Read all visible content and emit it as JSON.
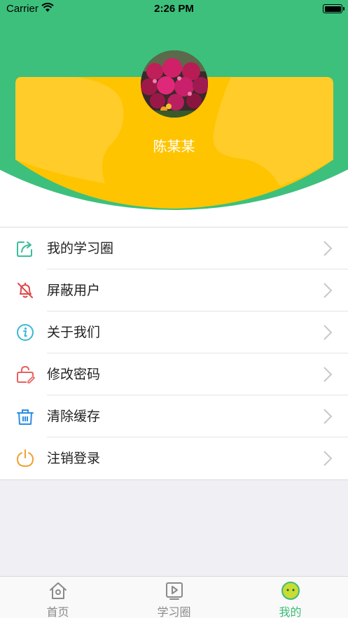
{
  "status_bar": {
    "carrier": "Carrier",
    "time": "2:26 PM"
  },
  "profile": {
    "name": "陈某某",
    "avatar_icon": "flowers-avatar"
  },
  "menu": {
    "items": [
      {
        "label": "我的学习圈",
        "icon": "share-icon",
        "color": "#3cbc9c"
      },
      {
        "label": "屏蔽用户",
        "icon": "bell-off-icon",
        "color": "#e04848"
      },
      {
        "label": "关于我们",
        "icon": "info-icon",
        "color": "#38b8d8"
      },
      {
        "label": "修改密码",
        "icon": "lock-edit-icon",
        "color": "#e86060"
      },
      {
        "label": "清除缓存",
        "icon": "trash-icon",
        "color": "#2a8ee0"
      },
      {
        "label": "注销登录",
        "icon": "power-icon",
        "color": "#f0a030"
      }
    ]
  },
  "tabbar": {
    "tabs": [
      {
        "label": "首页",
        "icon": "home-icon"
      },
      {
        "label": "学习圈",
        "icon": "play-icon"
      },
      {
        "label": "我的",
        "icon": "face-icon"
      }
    ],
    "active_color": "#3cbc78"
  },
  "colors": {
    "green": "#3dc07c",
    "yellow": "#ffc400"
  }
}
